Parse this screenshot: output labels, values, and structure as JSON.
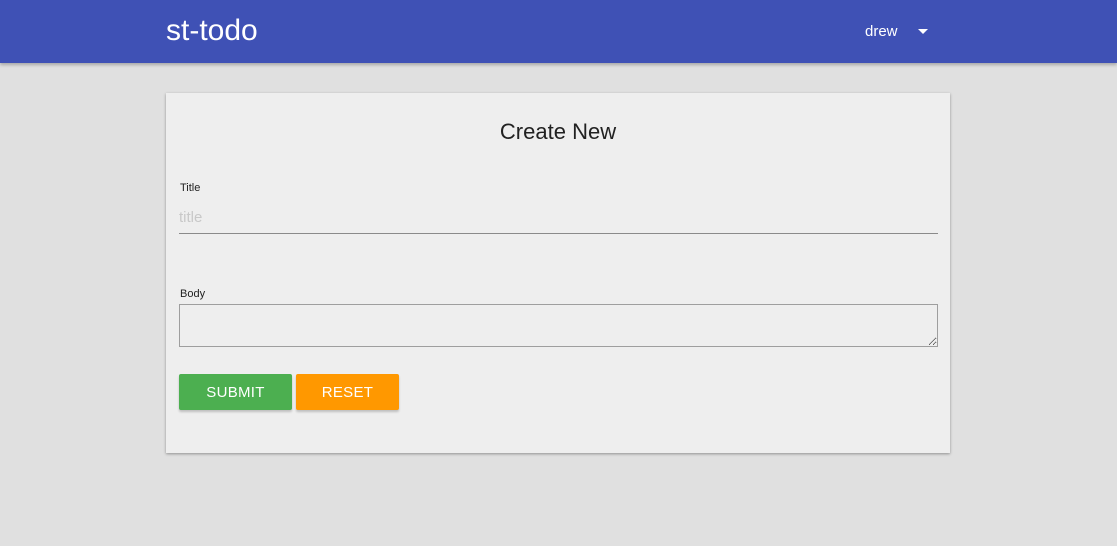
{
  "app": {
    "brand": "st-todo"
  },
  "user_menu": {
    "username": "drew",
    "icon": "caret-down-icon"
  },
  "form": {
    "title": "Create New",
    "title_field": {
      "label": "Title",
      "placeholder": "title",
      "value": ""
    },
    "body_field": {
      "label": "Body",
      "value": ""
    },
    "submit_label": "SUBMIT",
    "reset_label": "RESET"
  },
  "colors": {
    "navbar": "#3f51b5",
    "submit": "#4caf50",
    "reset": "#ff9800",
    "background": "#e0e0e0",
    "card": "#eeeeee"
  }
}
